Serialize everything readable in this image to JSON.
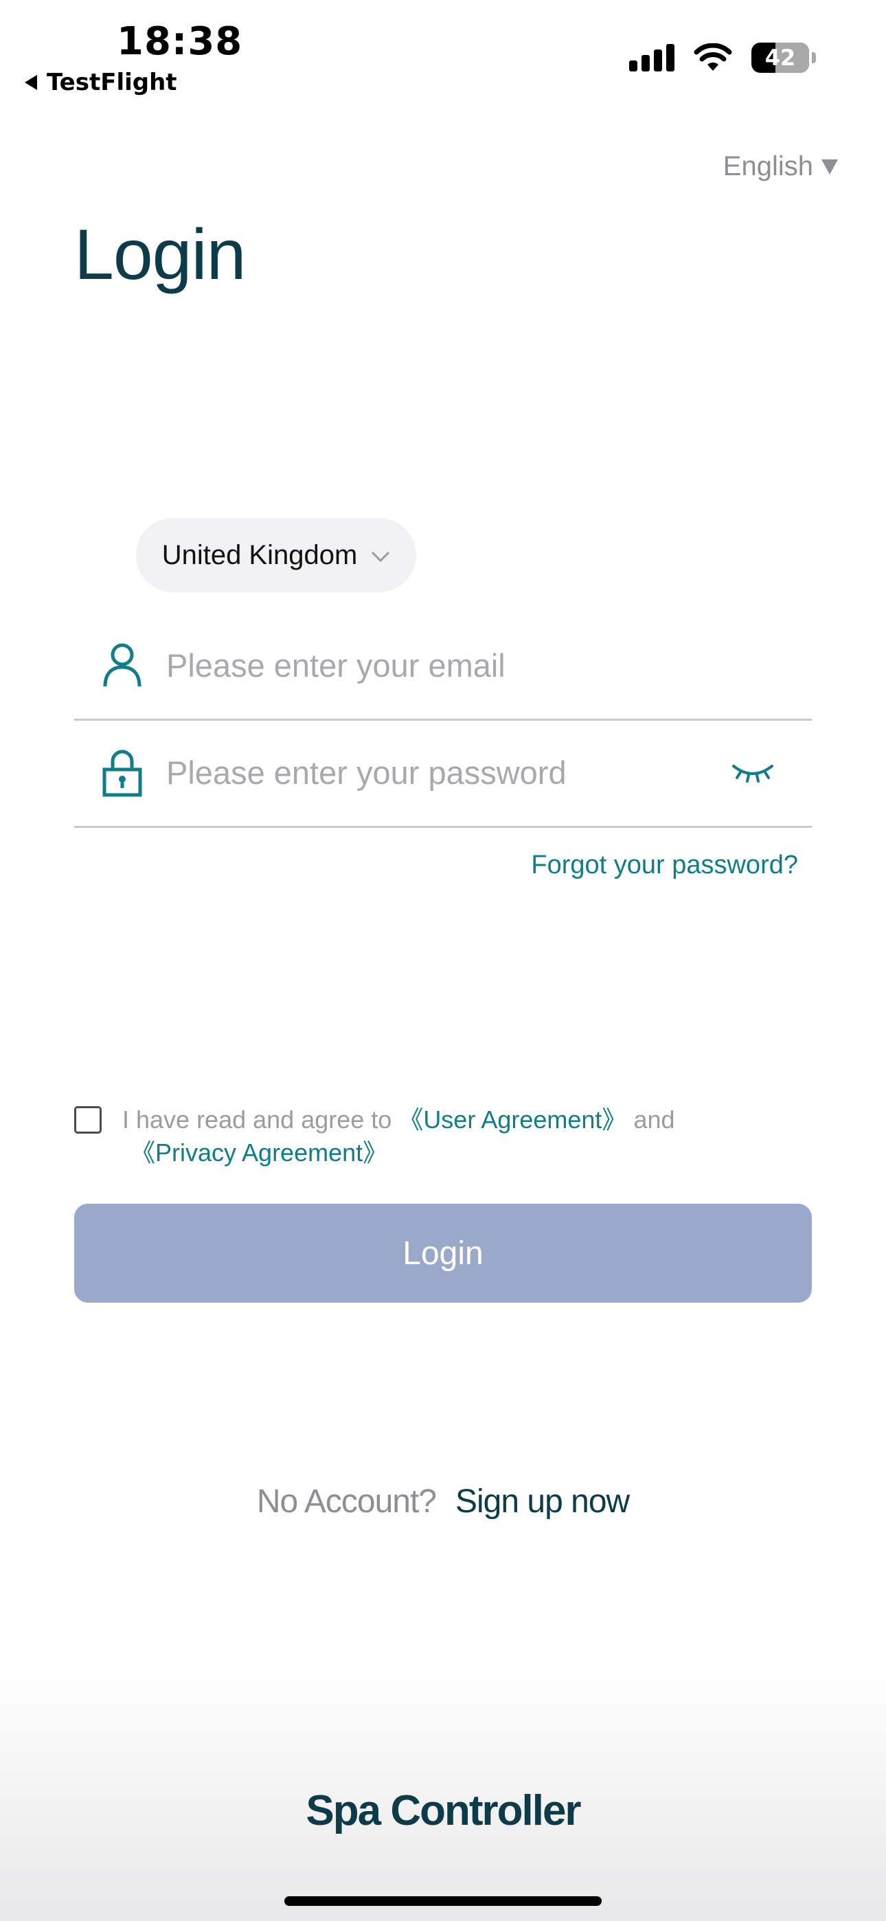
{
  "status_bar": {
    "time": "18:38",
    "back_label": "TestFlight",
    "battery_level": 42,
    "battery_text": "42"
  },
  "language": {
    "selected": "English"
  },
  "title": "Login",
  "country": {
    "selected": "United Kingdom"
  },
  "email": {
    "placeholder": "Please enter your email",
    "value": ""
  },
  "password": {
    "placeholder": "Please enter your password",
    "value": ""
  },
  "forgot_label": "Forgot your password?",
  "agreement": {
    "checked": false,
    "prefix": "I have read and agree to",
    "user_agreement": "《User Agreement》",
    "and": "and",
    "privacy_agreement": "《Privacy Agreement》"
  },
  "login_button": {
    "label": "Login",
    "color": "#9aa9c9"
  },
  "signup": {
    "prompt": "No Account?",
    "link": "Sign up now"
  },
  "brand": "Spa Controller",
  "colors": {
    "accent": "#0f7d8a",
    "title": "#0d3b4a"
  },
  "icons": {
    "email": "user-icon",
    "password": "lock-icon",
    "visibility": "eye-closed-icon",
    "country_dropdown": "chevron-down-icon",
    "language_dropdown": "caret-down-icon"
  }
}
